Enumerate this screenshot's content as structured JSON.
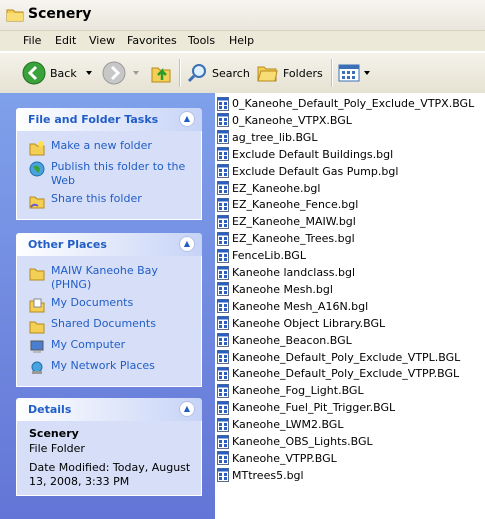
{
  "window": {
    "title": "Scenery"
  },
  "menu": [
    "File",
    "Edit",
    "View",
    "Favorites",
    "Tools",
    "Help"
  ],
  "toolbar": {
    "back_label": "Back",
    "search_label": "Search",
    "folders_label": "Folders"
  },
  "tasks_panel": {
    "title": "File and Folder Tasks",
    "items": [
      {
        "label": "Make a new folder",
        "icon": "new-folder-icon"
      },
      {
        "label": "Publish this folder to the Web",
        "icon": "publish-web-icon"
      },
      {
        "label": "Share this folder",
        "icon": "share-folder-icon"
      }
    ]
  },
  "places_panel": {
    "title": "Other Places",
    "items": [
      {
        "label": "MAIW Kaneohe Bay (PHNG)",
        "icon": "folder-icon"
      },
      {
        "label": "My Documents",
        "icon": "my-documents-icon"
      },
      {
        "label": "Shared Documents",
        "icon": "shared-documents-icon"
      },
      {
        "label": "My Computer",
        "icon": "my-computer-icon"
      },
      {
        "label": "My Network Places",
        "icon": "network-places-icon"
      }
    ]
  },
  "details_panel": {
    "title": "Details",
    "name": "Scenery",
    "type": "File Folder",
    "modified": "Date Modified: Today, August 13, 2008, 3:33 PM"
  },
  "files": [
    "0_Kaneohe_Default_Poly_Exclude_VTPX.BGL",
    "0_Kaneohe_VTPX.BGL",
    "ag_tree_lib.BGL",
    "Exclude Default Buildings.bgl",
    "Exclude Default Gas Pump.bgl",
    "EZ_Kaneohe.bgl",
    "EZ_Kaneohe_Fence.bgl",
    "EZ_Kaneohe_MAIW.bgl",
    "EZ_Kaneohe_Trees.bgl",
    "FenceLib.BGL",
    "Kaneohe landclass.bgl",
    "Kaneohe Mesh.bgl",
    "Kaneohe Mesh_A16N.bgl",
    "Kaneohe Object Library.BGL",
    "Kaneohe_Beacon.BGL",
    "Kaneohe_Default_Poly_Exclude_VTPL.BGL",
    "Kaneohe_Default_Poly_Exclude_VTPP.BGL",
    "Kaneohe_Fog_Light.BGL",
    "Kaneohe_Fuel_Pit_Trigger.BGL",
    "Kaneohe_LWM2.BGL",
    "Kaneohe_OBS_Lights.BGL",
    "Kaneohe_VTPP.BGL",
    "MTtrees5.bgl"
  ]
}
